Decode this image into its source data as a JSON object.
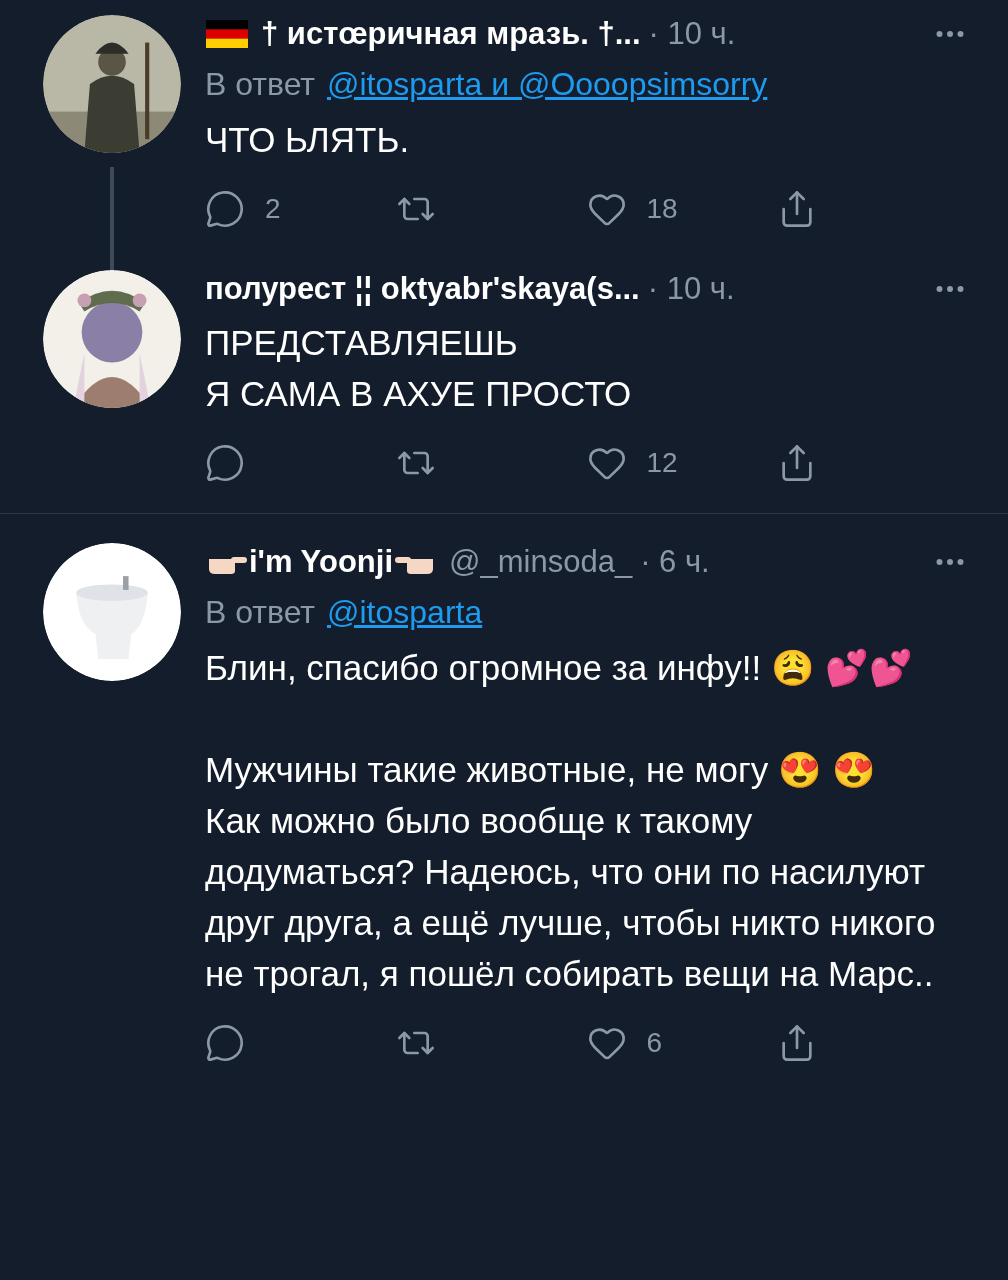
{
  "tweets": [
    {
      "flag": true,
      "name": "† истœричная мразь. †...",
      "time": "· 10 ч.",
      "reply_prefix": "В ответ",
      "reply_links": "@itosparta и @Oooopsimsorry",
      "blocks": [
        [
          "ЧТО ЬЛЯТЬ."
        ]
      ],
      "replies": "2",
      "likes": "18",
      "thread_down": true
    },
    {
      "name": "полурест ¦¦ oktyabr'skaya(s...",
      "time": "· 10 ч.",
      "blocks": [
        [
          "ПРЕДСТАВЛЯЕШЬ",
          "Я САМА В АХУЕ ПРОСТО"
        ]
      ],
      "likes": "12"
    },
    {
      "hands": true,
      "name": "i'm Yoonji",
      "handle": "@_minsoda_",
      "time": "· 6 ч.",
      "reply_prefix": "В ответ",
      "reply_links": "@itosparta",
      "blocks": [
        [
          "Блин, спасибо огромное за инфу!! 😩 💕💕"
        ],
        [
          "Мужчины такие животные, не могу 😍 😍",
          "Как можно было вообще к такому додуматься? Надеюсь, что они по насилуют друг друга, а ещё лучше, чтобы никто никого не трогал, я пошёл собирать вещи на Марс.."
        ]
      ],
      "likes": "6"
    }
  ]
}
